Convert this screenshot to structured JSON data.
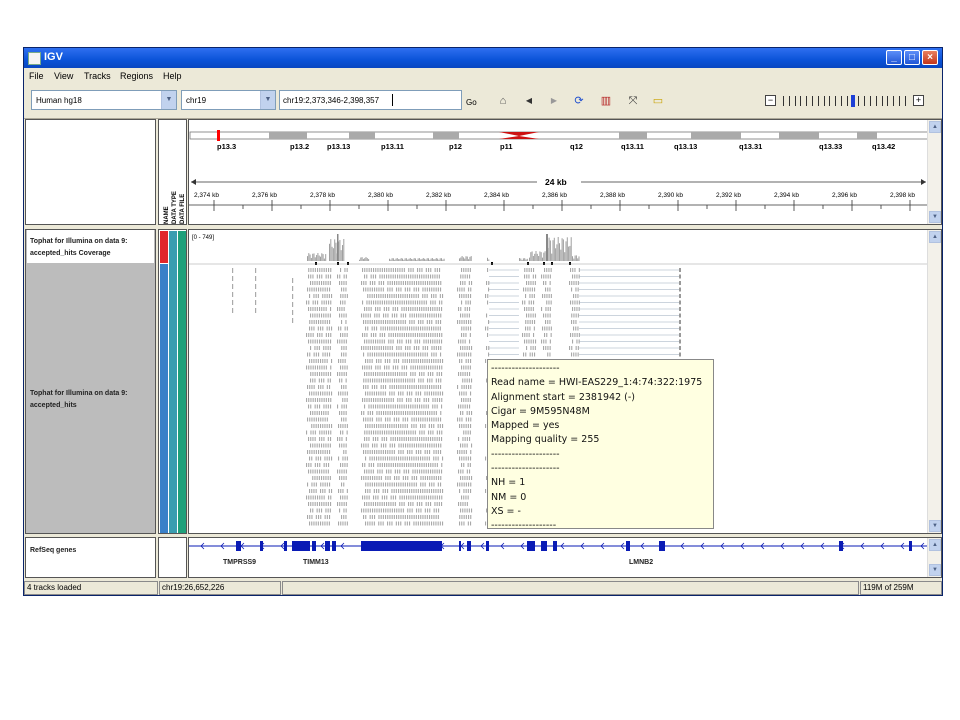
{
  "window": {
    "title": "IGV"
  },
  "menu": [
    "File",
    "View",
    "Tracks",
    "Regions",
    "Help"
  ],
  "toolbar": {
    "genome": "Human hg18",
    "chromosome": "chr19",
    "locus": "chr19:2,373,346-2,398,357",
    "go_label": "Go"
  },
  "ideogram": {
    "bands": [
      "p13.3",
      "p13.2",
      "p13.13",
      "p13.11",
      "p12",
      "p11",
      "q12",
      "q13.11",
      "q13.13",
      "q13.31",
      "q13.33",
      "q13.42"
    ],
    "span_label": "24 kb",
    "ruler_ticks": [
      "2,374 kb",
      "2,376 kb",
      "2,378 kb",
      "2,380 kb",
      "2,382 kb",
      "2,384 kb",
      "2,386 kb",
      "2,388 kb",
      "2,390 kb",
      "2,392 kb",
      "2,394 kb",
      "2,396 kb",
      "2,398 kb"
    ]
  },
  "attribute_headers": [
    "NAME",
    "DATA TYPE",
    "DATA FILE"
  ],
  "tracks": {
    "coverage": {
      "name": "Tophat for Illumina on data 9: accepted_hits Coverage",
      "range": "[0 - 749]"
    },
    "alignments": {
      "name": "Tophat for Illumina on data 9: accepted_hits"
    },
    "genes": {
      "name": "RefSeq genes",
      "labels": [
        "TMPRSS9",
        "TIMM13",
        "LMNB2"
      ]
    }
  },
  "tooltip": {
    "lines": [
      "--------------------",
      "Read name = HWI-EAS229_1:4:74:322:1975",
      "Alignment start = 2381942 (-)",
      "Cigar = 9M595N48M",
      "Mapped = yes",
      "Mapping quality = 255",
      "--------------------",
      "--------------------",
      "NH = 1",
      "NM = 0",
      "XS = -",
      "-------------------"
    ]
  },
  "status": {
    "message": "4 tracks loaded",
    "position": "chr19:26,652,226",
    "memory": "119M of 259M"
  },
  "colors": {
    "titlebar": "#0a53d8",
    "coverage": "#a0a0a0",
    "gene": "#0a1bb5",
    "centromere": "#cc1111",
    "attr_name": "#e0262b",
    "attr_type": "#3a9db0",
    "attr_file": "#1fa07a"
  }
}
